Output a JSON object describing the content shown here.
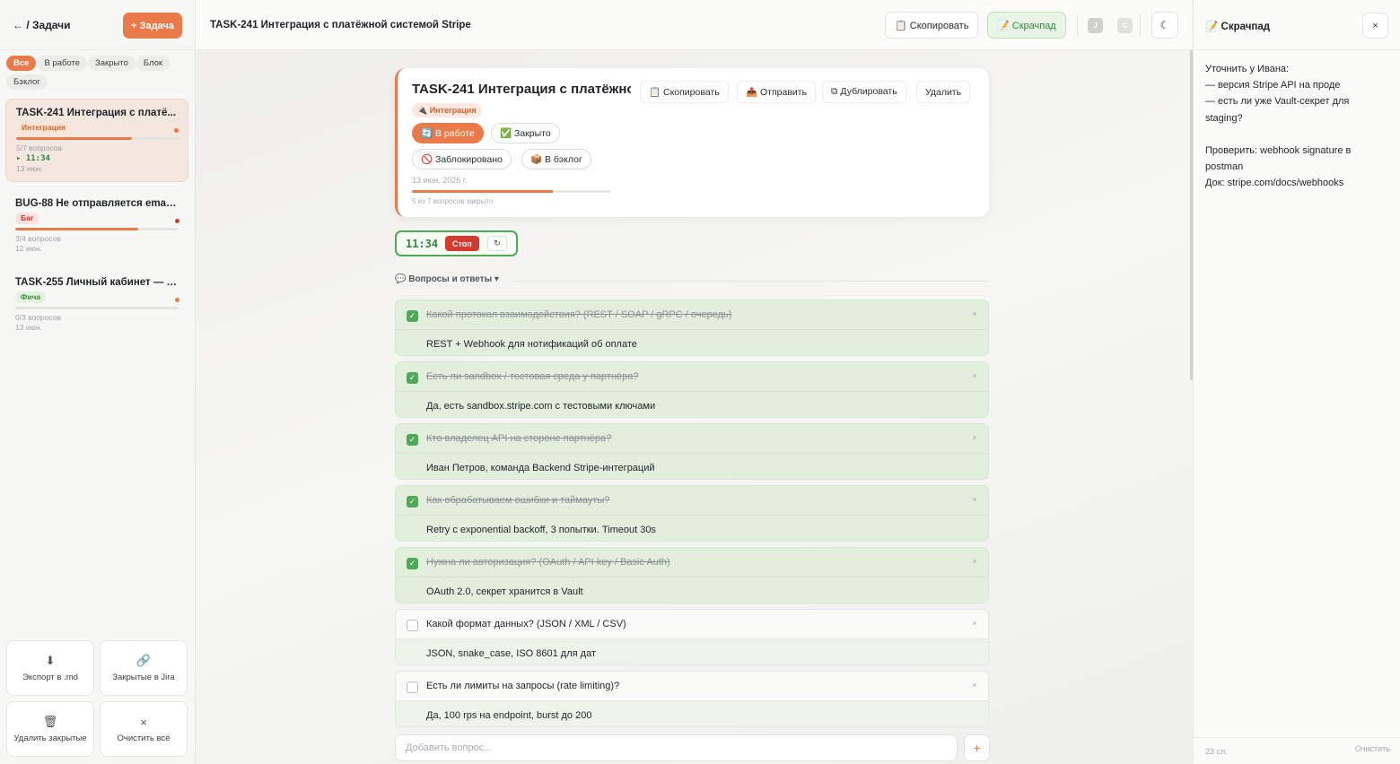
{
  "sidebar": {
    "back_label": "← / Задачи",
    "new_task_label": "+ Задача",
    "filters": [
      "Все",
      "В работе",
      "Закрыто",
      "Блок",
      "Бэклог"
    ],
    "tasks": [
      {
        "title": "TASK-241 Интеграция с платё...",
        "tag": "Интеграция",
        "questions": "5/7 вопросов",
        "timer": "▸ 11:34",
        "date": "13 июн.",
        "progress": 0.71
      },
      {
        "title": "BUG-88 Не отправляется email...",
        "tag": "Баг",
        "questions": "3/4 вопросов",
        "timer": "",
        "date": "12 июн.",
        "progress": 0.75
      },
      {
        "title": "TASK-255 Личный кабинет — и...",
        "tag": "Фича",
        "questions": "0/3 вопросов",
        "timer": "",
        "date": "13 июн.",
        "progress": 0
      }
    ],
    "actions": {
      "export": "Экспорт в .md",
      "jira": "Закрытые в Jira",
      "delete_closed": "Удалить закрытые",
      "clear_all": "Очистить всё"
    }
  },
  "topbar": {
    "title": "TASK-241 Интеграция с платёжной системой Stripe",
    "copy_label": "📋 Скопировать",
    "scratch_label": "📝 Скрачпад",
    "avatar_j": "J",
    "avatar_c": "C"
  },
  "card": {
    "title": "TASK-241 Интеграция с платёжной системой Stripe",
    "tag": "🔌 Интеграция",
    "copy_label": "📋 Скопировать",
    "send_label": "📤 Отправить",
    "duplicate_label": "⧉ Дублировать",
    "delete_label": "Удалить",
    "status_work": "🔄 В работе",
    "status_closed": "✅ Закрыто",
    "status_blocked": "🚫 Заблокировано",
    "status_backlog": "📦 В бэклог",
    "date": "13 июн. 2026 г.",
    "progress_text": "5 из 7 вопросов закрыто",
    "progress": 0.71
  },
  "timer": {
    "value": "11:34",
    "stop_label": "Стоп",
    "reset_label": "↻"
  },
  "qa": {
    "label": "💬 Вопросы и ответы  ▾",
    "items": [
      {
        "q": "Какой протокол взаимодействия? (REST / SOAP / gRPC / очередь)",
        "a": "REST + Webhook для нотификаций об оплате",
        "done": true
      },
      {
        "q": "Есть ли sandbox / тестовая среда у партнёра?",
        "a": "Да, есть sandbox.stripe.com с тестовыми ключами",
        "done": true
      },
      {
        "q": "Кто владелец API на стороне партнёра?",
        "a": "Иван Петров, команда Backend Stripe-интеграций",
        "done": true
      },
      {
        "q": "Как обрабатываем ошибки и таймауты?",
        "a": "Retry с exponential backoff, 3 попытки. Timeout 30s",
        "done": true
      },
      {
        "q": "Нужна ли авторизация? (OAuth / API key / Basic Auth)",
        "a": "OAuth 2.0, секрет хранится в Vault",
        "done": true
      },
      {
        "q": "Какой формат данных? (JSON / XML / CSV)",
        "a": "JSON, snake_case, ISO 8601 для дат",
        "done": false
      },
      {
        "q": "Есть ли лимиты на запросы (rate limiting)?",
        "a": "Да, 100 rps на endpoint, burst до 200",
        "done": false
      }
    ],
    "add_placeholder": "Добавить вопрос...",
    "add_button": "+"
  },
  "scratchpad": {
    "title": "📝 Скрачпад",
    "close_label": "×",
    "text": "Уточнить у Ивана:\n— версия Stripe API на проде\n— есть ли уже Vault-секрет для staging?\n\nПроверить: webhook signature в postman\nДок: stripe.com/docs/webhooks",
    "count": "23 сл.",
    "clear_label": "Очистить"
  },
  "colors": {
    "accent": "#ea7a48",
    "success": "#4eaa57",
    "danger": "#d63a2f"
  }
}
